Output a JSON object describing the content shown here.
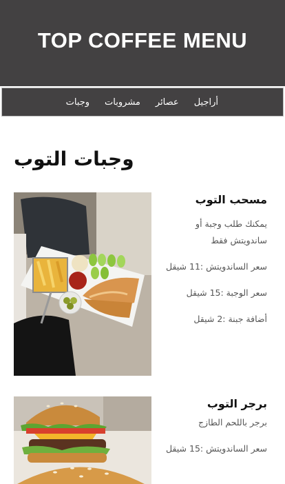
{
  "header": {
    "title": "TOP COFFEE MENU"
  },
  "nav": {
    "items": [
      {
        "label": "أراجيل"
      },
      {
        "label": "عصائر"
      },
      {
        "label": "مشروبات"
      },
      {
        "label": "وجبات"
      }
    ]
  },
  "section": {
    "title": "وجبات التوب"
  },
  "menu_items": [
    {
      "name": "مسحب التوب",
      "lines": [
        "يمكنك طلب وجبة أو ساندويتش فقط",
        "سعر الساندويتش :11 شيقل",
        "سعر الوجبة :15 شيقل",
        "أضافة جبنة :2 شيقل"
      ]
    },
    {
      "name": "برجر التوب",
      "lines": [
        "برجر باللحم الطازج",
        "سعر الساندويتش :15 شيقل"
      ]
    }
  ],
  "colors": {
    "header_bg": "#434142",
    "header_text": "#ffffff"
  }
}
